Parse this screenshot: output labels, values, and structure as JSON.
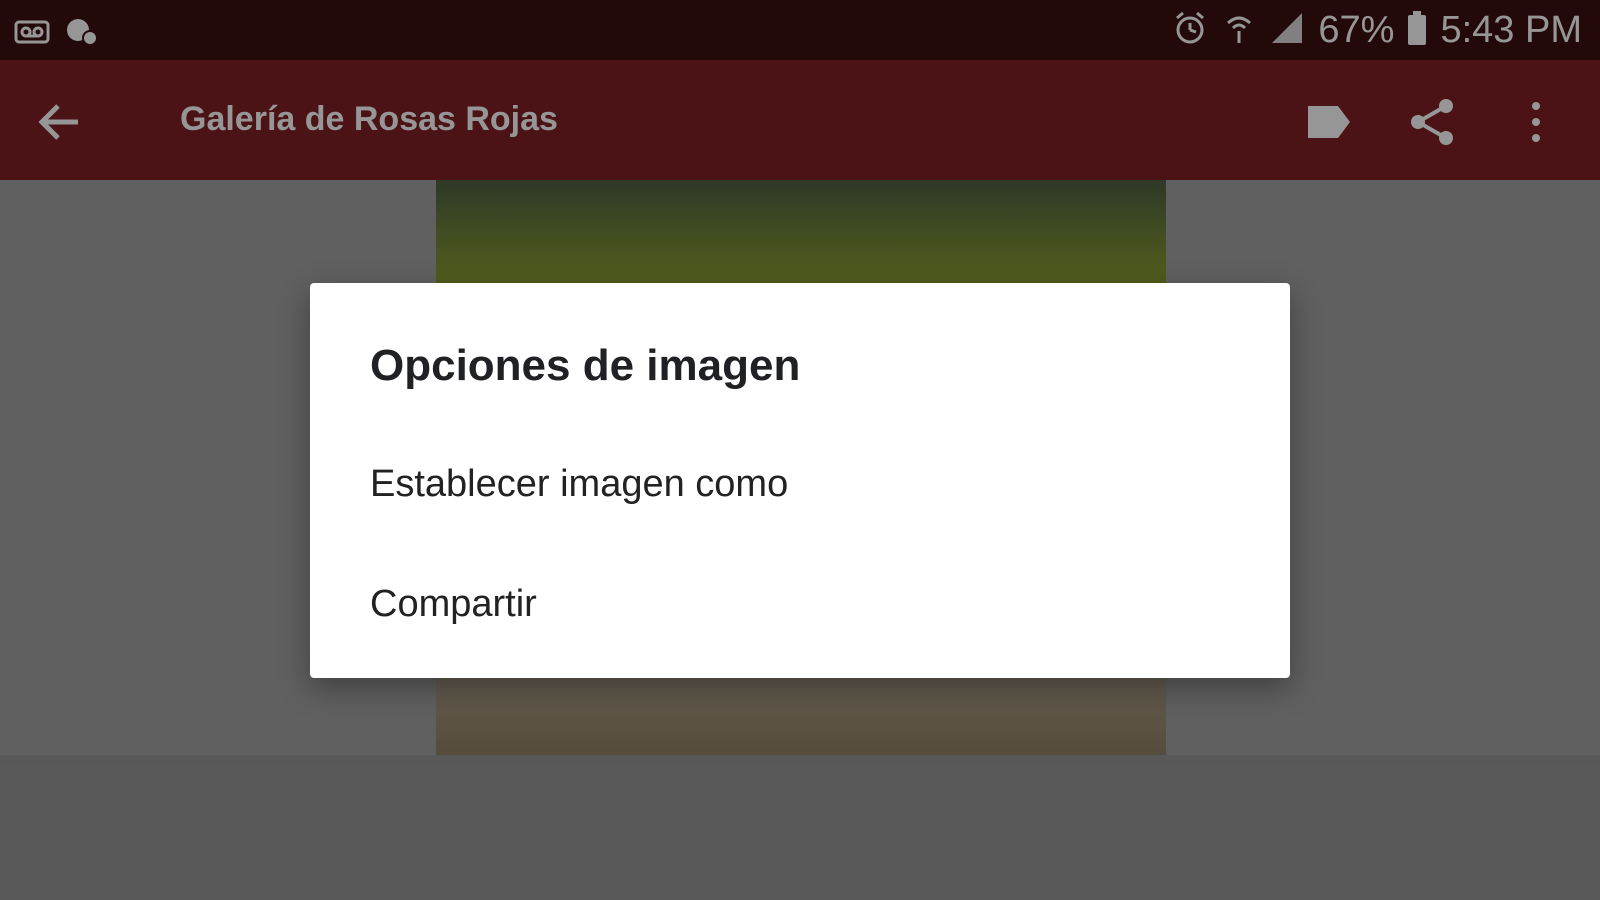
{
  "status_bar": {
    "left_icons": [
      "voicemail-icon",
      "chat-icon"
    ],
    "right_icons": [
      "alarm-icon",
      "wifi-icon",
      "signal-icon"
    ],
    "battery_percent": "67%",
    "time": "5:43 PM"
  },
  "toolbar": {
    "title": "Galería de Rosas Rojas",
    "actions": [
      "label-icon",
      "share-icon",
      "more-vert-icon"
    ]
  },
  "dialog": {
    "title": "Opciones de imagen",
    "items": [
      {
        "label": "Establecer imagen como"
      },
      {
        "label": "Compartir"
      }
    ]
  },
  "colors": {
    "status_bar": "#3b0f12",
    "toolbar": "#7a1f25",
    "scrim": "#000000",
    "dialog_bg": "#ffffff"
  }
}
